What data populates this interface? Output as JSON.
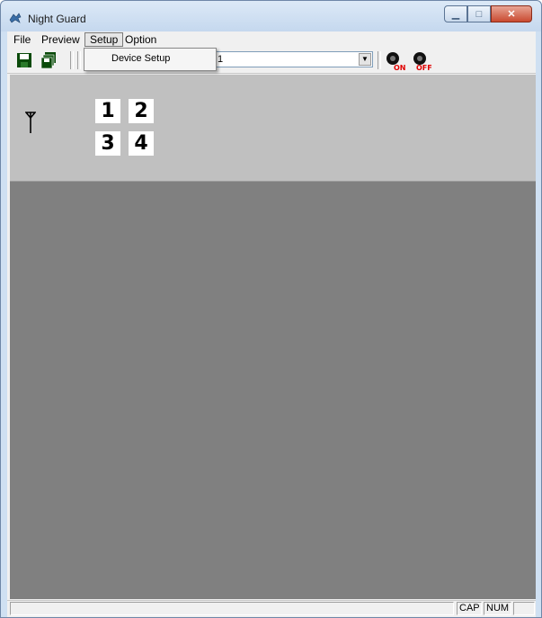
{
  "window": {
    "title": "Night Guard",
    "icon": "night-guard-app-icon",
    "controls": {
      "minimize": "minimize-icon",
      "maximize": "maximize-icon",
      "close": "close-icon"
    }
  },
  "menubar": {
    "items": [
      {
        "label": "File"
      },
      {
        "label": "Preview"
      },
      {
        "label": "Setup",
        "active": true
      },
      {
        "label": "Option"
      }
    ]
  },
  "setup_menu": {
    "items": [
      {
        "label": "Device Setup"
      }
    ]
  },
  "toolbar": {
    "icons": [
      "save-icon",
      "save-all-icon",
      "record-on-icon",
      "record-off-icon"
    ],
    "combo_value": "1",
    "on_label": "ON",
    "off_label": "OFF"
  },
  "channels": [
    "1",
    "2",
    "3",
    "4"
  ],
  "statusbar": {
    "cap": "CAP",
    "num": "NUM"
  },
  "colors": {
    "panel": "#c0c0c0",
    "view": "#808080",
    "record_red": "#e00000"
  }
}
